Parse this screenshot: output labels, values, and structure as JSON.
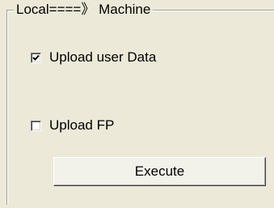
{
  "group": {
    "title": "Local====》 Machine"
  },
  "options": {
    "upload_user_data": {
      "label": "Upload user Data",
      "checked": true
    },
    "upload_fp": {
      "label": "Upload FP",
      "checked": false
    }
  },
  "actions": {
    "execute_label": "Execute"
  },
  "icons": {
    "checked": "checkmark-icon"
  },
  "colors": {
    "background": "#ece9d8",
    "button_face": "#f3f2ea",
    "text": "#000000"
  }
}
